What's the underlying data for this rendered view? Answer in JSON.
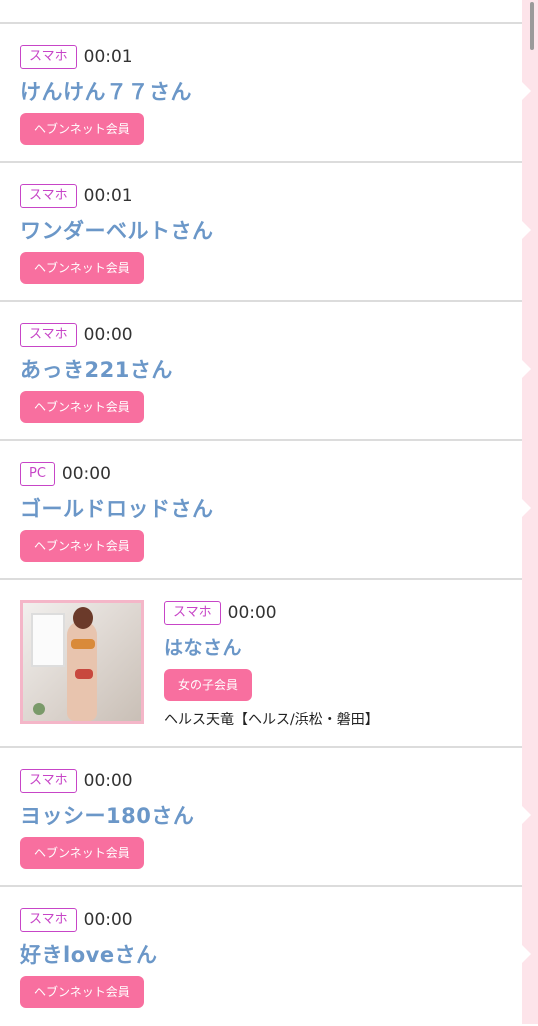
{
  "entries": [
    {
      "device": "スマホ",
      "time": "00:01",
      "name": "けんけん７７さん",
      "badge": "ヘブンネット会員"
    },
    {
      "device": "スマホ",
      "time": "00:01",
      "name": "ワンダーベルトさん",
      "badge": "ヘブンネット会員"
    },
    {
      "device": "スマホ",
      "time": "00:00",
      "name": "あっき221さん",
      "badge": "ヘブンネット会員"
    },
    {
      "device": "PC",
      "time": "00:00",
      "name": "ゴールドロッドさん",
      "badge": "ヘブンネット会員"
    },
    {
      "device": "スマホ",
      "time": "00:00",
      "name": "はなさん",
      "badge": "女の子会員",
      "shop": "ヘルス天竜【ヘルス/浜松・磐田】"
    },
    {
      "device": "スマホ",
      "time": "00:00",
      "name": "ヨッシー180さん",
      "badge": "ヘブンネット会員"
    },
    {
      "device": "スマホ",
      "time": "00:00",
      "name": "好きloveさん",
      "badge": "ヘブンネット会員"
    }
  ],
  "colors": {
    "badge": "#f86f9f",
    "device_border": "#c745c7",
    "name": "#6b97c8",
    "side": "#fde4ea"
  }
}
